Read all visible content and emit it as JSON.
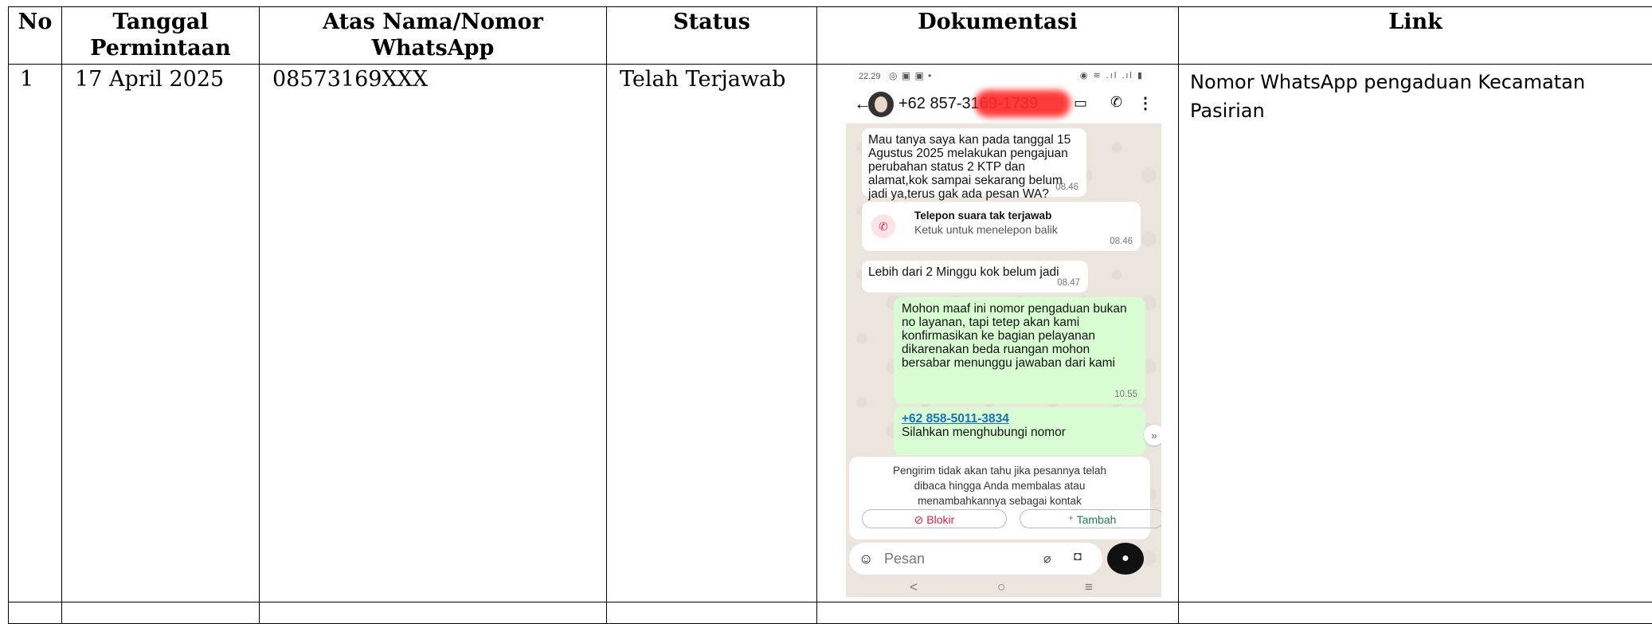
{
  "table": {
    "headers": {
      "no": "No",
      "tanggal": "Tanggal Permintaan",
      "atas_nama": "Atas Nama/Nomor WhatsApp",
      "status": "Status",
      "dokumentasi": "Dokumentasi",
      "link": "Link"
    },
    "rows": [
      {
        "no": "1",
        "tanggal": "17 April 2025",
        "atas_nama": "08573169XXX",
        "status": "Telah Terjawab",
        "link": "Nomor WhatsApp pengaduan Kecamatan Pasirian"
      }
    ]
  },
  "screenshot": {
    "status_time": "22.29",
    "contact_number": "+62 857-3169-1739",
    "messages": [
      {
        "text": "Mau tanya saya kan pada tanggal 15 Agustus 2025 melakukan pengajuan perubahan status 2 KTP dan alamat,kok sampai sekarang belum jadi ya,terus gak ada pesan WA?",
        "time": "08.46"
      },
      {
        "text": "Lebih dari 2 Minggu kok belum jadi",
        "time": "08.47"
      },
      {
        "text": "Mohon maaf ini nomor pengaduan bukan no layanan, tapi tetep akan kami konfirmasikan ke bagian pelayanan dikarenakan beda ruangan mohon bersabar menunggu jawaban dari kami",
        "time": "10.55"
      }
    ],
    "missed_call": {
      "title": "Telepon suara tak terjawab",
      "subtitle": "Ketuk untuk menelepon balik",
      "time": "08.46"
    },
    "forward": {
      "number": "+62 858-5011-3834",
      "text": "Silahkan menghubungi nomor"
    },
    "notice_text": "Pengirim tidak akan tahu jika pesannya telah dibaca hingga Anda membalas atau menambahkannya sebagai kontak",
    "block_label": "Blokir",
    "add_label": "Tambah",
    "input_placeholder": "Pesan"
  }
}
